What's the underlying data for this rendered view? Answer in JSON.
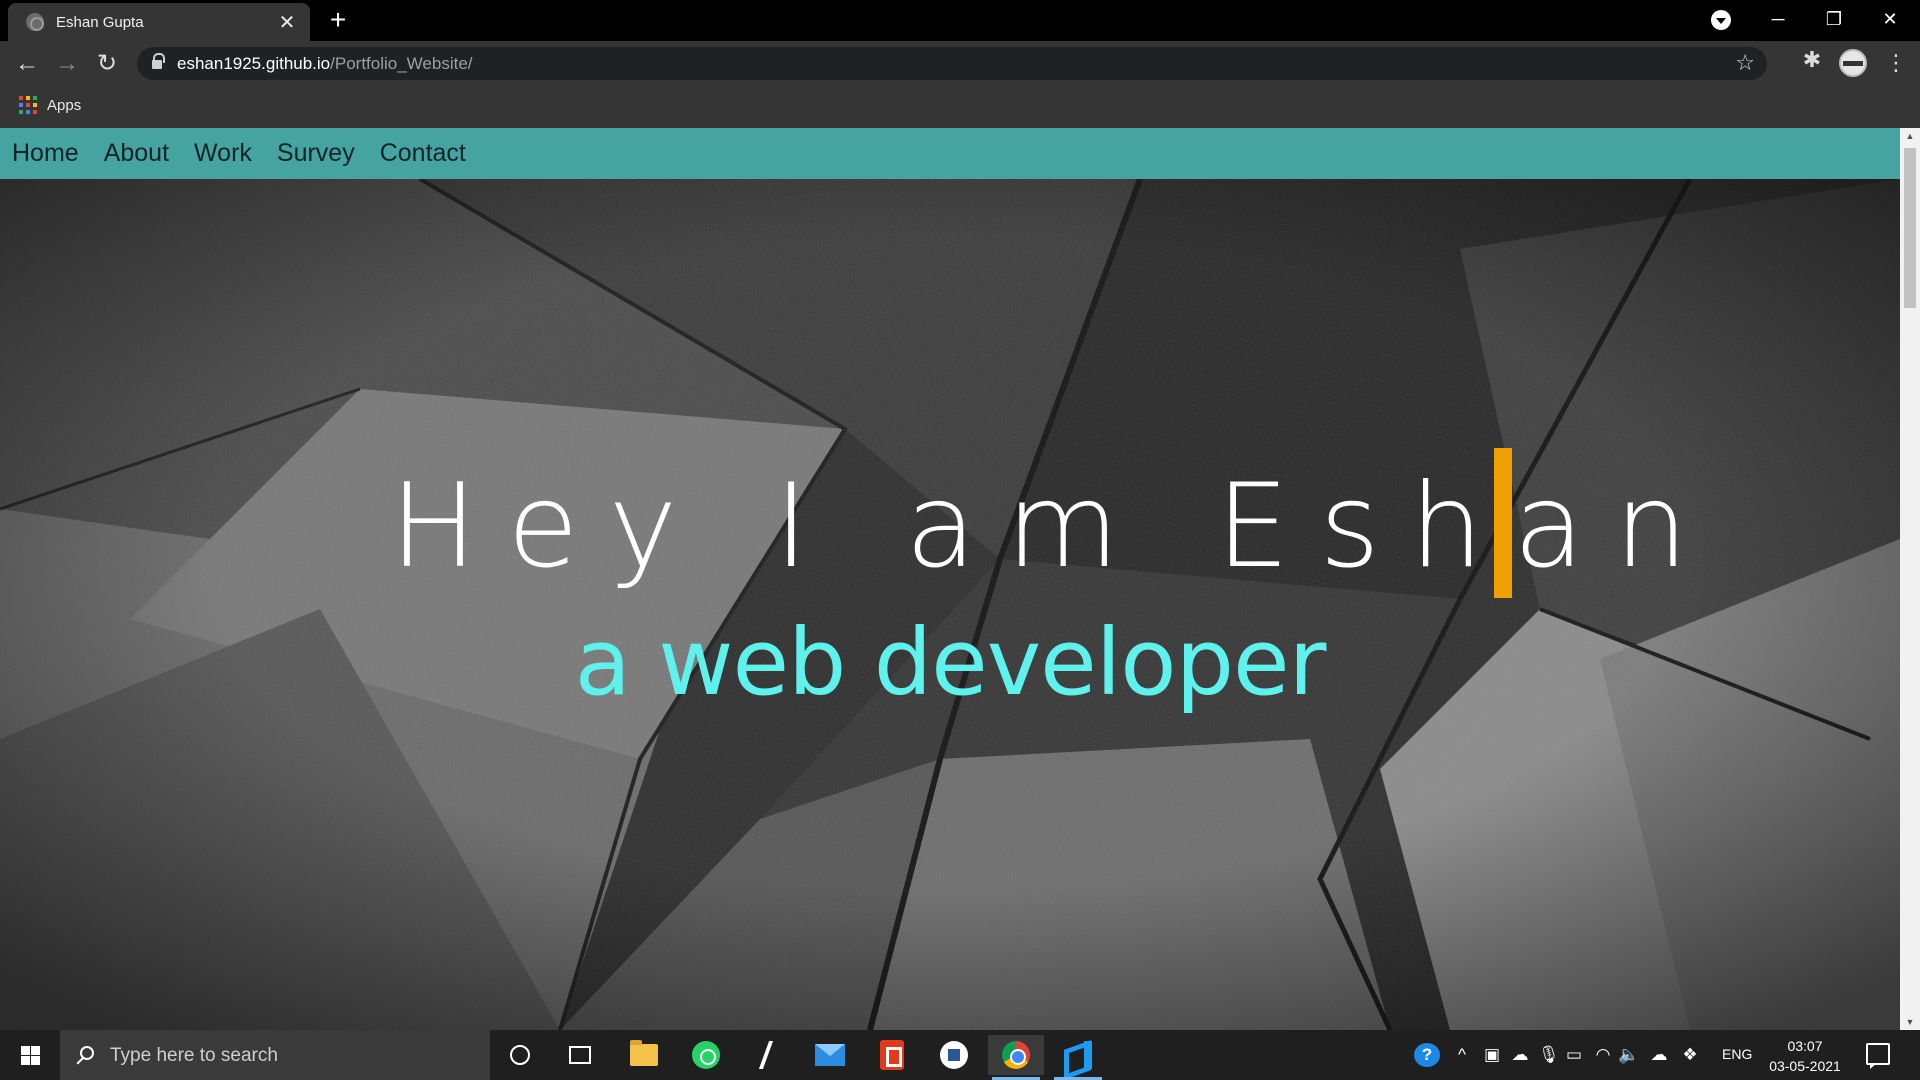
{
  "browser": {
    "tab": {
      "title": "Eshan Gupta",
      "close_glyph": "✕"
    },
    "new_tab_glyph": "+",
    "window_controls": {
      "minimize": "─",
      "restore": "❐",
      "close": "✕"
    },
    "nav": {
      "back": "←",
      "forward": "→",
      "reload": "↻"
    },
    "url": {
      "host": "eshan1925.github.io",
      "path": "/Portfolio_Website/"
    },
    "star_glyph": "☆",
    "extensions_glyph": "✱",
    "menu_glyph": "⋮",
    "bookmarks": {
      "apps_label": "Apps",
      "apps_grid_colors": [
        "#ea4335",
        "#fbbc04",
        "#34a853",
        "#4285f4",
        "#ea4335",
        "#fbbc04",
        "#34a853",
        "#4285f4",
        "#ea4335"
      ]
    }
  },
  "site": {
    "nav": [
      {
        "label": "Home"
      },
      {
        "label": "About"
      },
      {
        "label": "Work"
      },
      {
        "label": "Survey"
      },
      {
        "label": "Contact"
      }
    ],
    "hero": {
      "headline": "Hey I am Eshan",
      "subline": "a web developer",
      "cursor_color": "#f0a000",
      "subline_color": "#5ff2ec"
    },
    "navbar_color": "#45a3a0"
  },
  "scrollbar": {
    "up": "▲",
    "down": "▼"
  },
  "taskbar": {
    "search_placeholder": "Type here to search",
    "apps": [
      "cortana",
      "task-view",
      "file-explorer",
      "whatsapp",
      "sublime-text",
      "mail",
      "office",
      "word-app",
      "chrome",
      "vscode"
    ],
    "tray": {
      "help": "?",
      "chevron": "^",
      "language": "ENG",
      "time": "03:07",
      "date": "03-05-2021"
    }
  }
}
